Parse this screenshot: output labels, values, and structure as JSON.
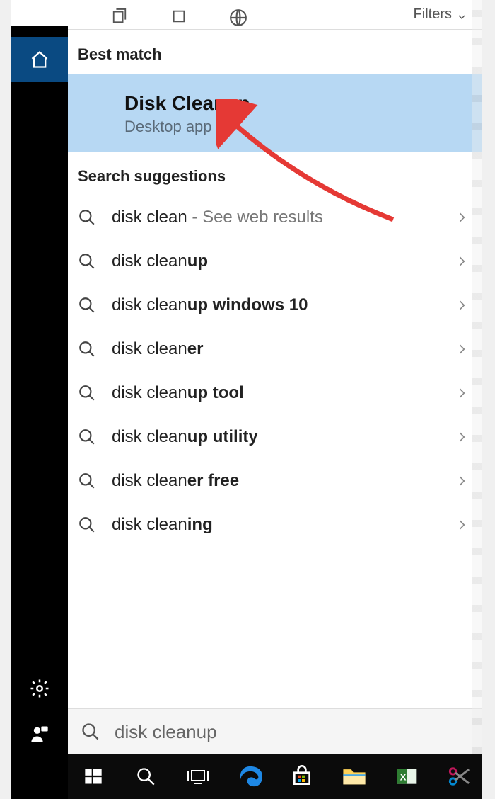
{
  "topbar": {
    "filters_label": "Filters"
  },
  "sections": {
    "best_match_header": "Best match",
    "suggestions_header": "Search suggestions"
  },
  "best_match": {
    "title": "Disk Cleanup",
    "subtitle": "Desktop app"
  },
  "suggestions": [
    {
      "typed": "disk clean",
      "completion": "",
      "extra": " - See web results"
    },
    {
      "typed": "disk clean",
      "completion": "up",
      "extra": ""
    },
    {
      "typed": "disk clean",
      "completion": "up windows 10",
      "extra": ""
    },
    {
      "typed": "disk clean",
      "completion": "er",
      "extra": ""
    },
    {
      "typed": "disk clean",
      "completion": "up tool",
      "extra": ""
    },
    {
      "typed": "disk clean",
      "completion": "up utility",
      "extra": ""
    },
    {
      "typed": "disk clean",
      "completion": "er free",
      "extra": ""
    },
    {
      "typed": "disk clean",
      "completion": "ing",
      "extra": ""
    }
  ],
  "search": {
    "query_typed": "disk cleanu",
    "query_completion": "p"
  }
}
